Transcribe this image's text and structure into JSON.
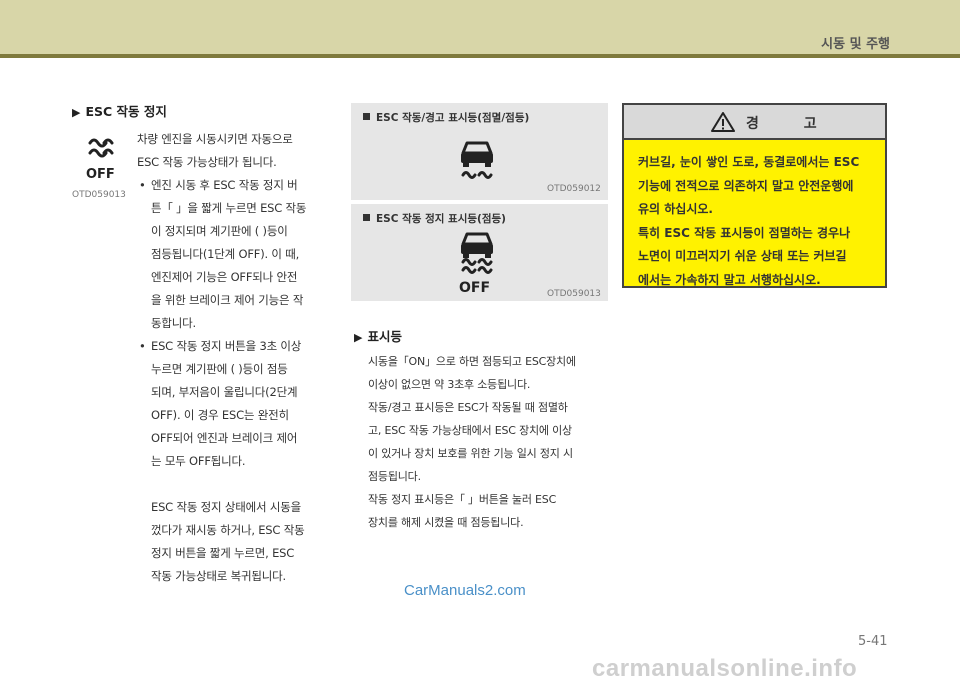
{
  "header": {
    "section": "시동 및 주행"
  },
  "left": {
    "heading": "ESC 작동 정지",
    "icon_label": "OFF",
    "image_code": "OTD059013",
    "paras": [
      "차량 엔진을 시동시키면 자동으로",
      "ESC 작동 가능상태가 됩니다."
    ],
    "bullet1": [
      "엔진 시동 후 ESC 작동 정지 버",
      "튼「 」을 짧게 누르면 ESC 작동",
      "이 정지되며 계기판에 ( )등이",
      "점등됩니다(1단계 OFF). 이 때,",
      "엔진제어 기능은 OFF되나 안전",
      "을 위한 브레이크 제어 기능은 작",
      "동합니다."
    ],
    "bullet2": [
      "ESC 작동 정지 버튼을 3초 이상",
      "누르면 계기판에 ( )등이 점등",
      "되며, 부저음이 울립니다(2단계",
      "OFF). 이 경우 ESC는 완전히",
      "OFF되어 엔진과 브레이크 제어",
      "는 모두 OFF됩니다."
    ],
    "para3": [
      "ESC 작동 정지 상태에서 시동을",
      "껐다가 재시동 하거나, ESC 작동",
      "정지 버튼을 짧게 누르면, ESC",
      "작동 가능상태로 복귀됩니다."
    ]
  },
  "middle": {
    "panel1_title": "ESC 작동/경고 표시등(점멸/점등)",
    "panel1_code": "OTD059012",
    "panel2_title": "ESC 작동 정지 표시등(점등)",
    "panel2_label": "OFF",
    "panel2_code": "OTD059013",
    "heading": "표시등",
    "lines": [
      "시동을「ON」으로 하면 점등되고 ESC장치에",
      "이상이 없으면 약 3초후 소등됩니다.",
      "작동/경고 표시등은 ESC가 작동될 때 점멸하",
      "고, ESC 작동 가능상태에서 ESC 장치에 이상",
      "이 있거나 장치 보호를 위한 기능 일시 정지 시",
      "점등됩니다.",
      "작동 정지 표시등은「 」버튼을 눌러 ESC",
      "장치를 해제 시켰을 때 점등됩니다."
    ]
  },
  "warning": {
    "title": "경 고",
    "lines": [
      "커브길, 눈이 쌓인 도로, 동결로에서는 ESC",
      "기능에 전적으로 의존하지 말고 안전운행에",
      "유의 하십시오.",
      "특히 ESC 작동 표시등이 점멸하는 경우나",
      "노면이 미끄러지기 쉬운 상태 또는 커브길",
      "에서는 가속하지 말고 서행하십시오."
    ]
  },
  "footer": {
    "watermark": "CarManuals2.com",
    "page_number": "5-41",
    "site": "carmanualsonline.info"
  }
}
